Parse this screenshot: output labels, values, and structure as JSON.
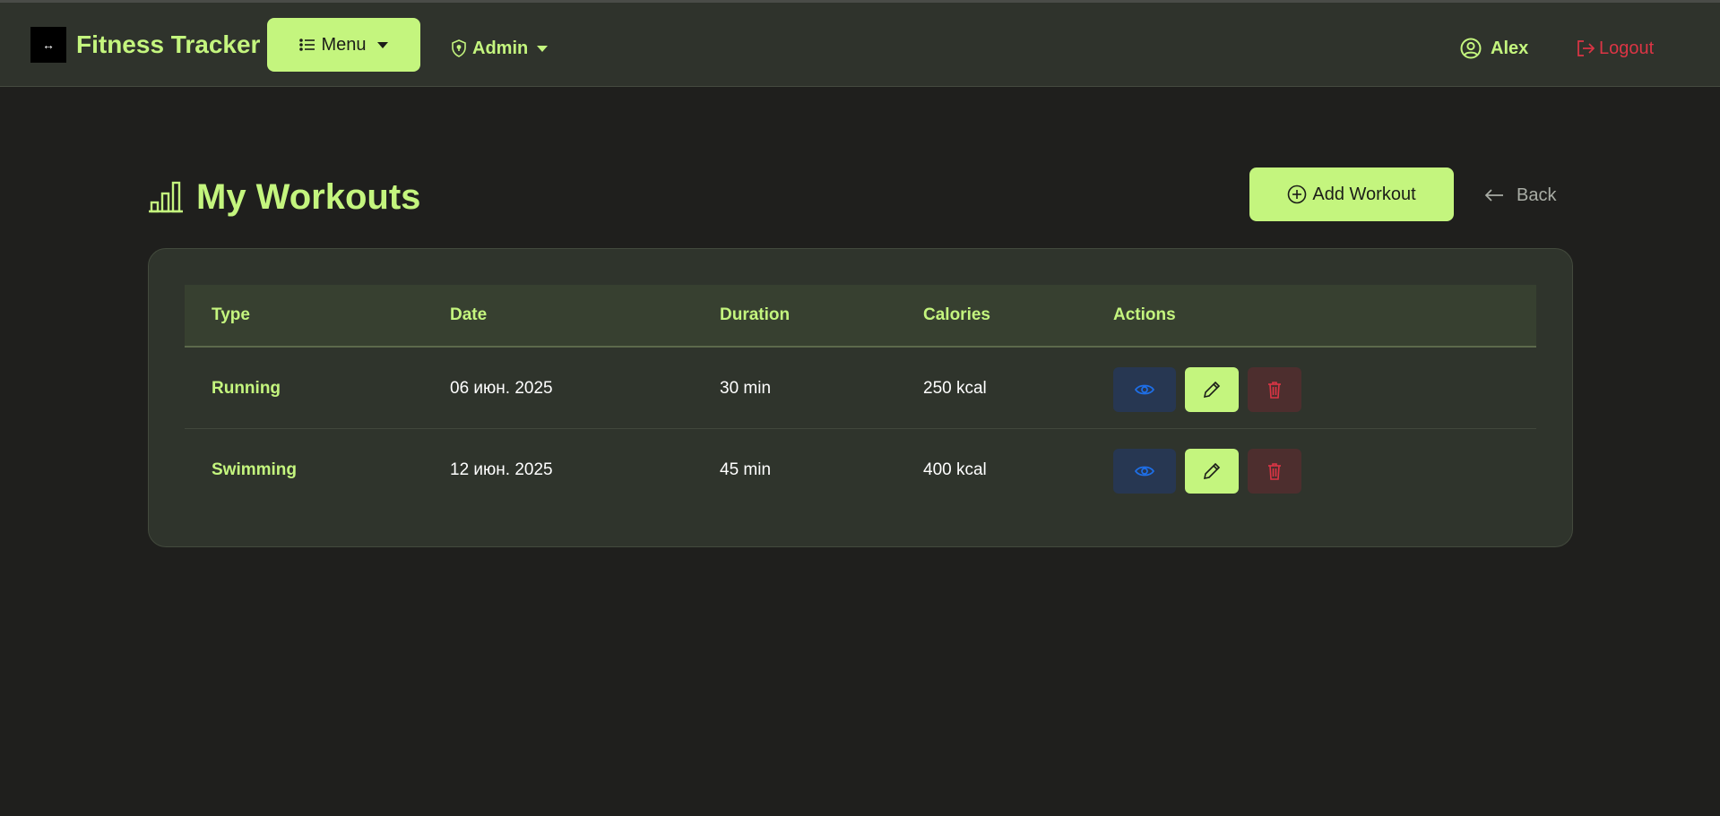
{
  "navbar": {
    "brand": "Fitness Tracker",
    "brand_logo_glyph": "↔",
    "menu_label": "Menu",
    "admin_label": "Admin",
    "user_name": "Alex",
    "logout_label": "Logout"
  },
  "page": {
    "title": "My Workouts",
    "add_button": "Add Workout",
    "back_link": "Back"
  },
  "table": {
    "headers": [
      "Type",
      "Date",
      "Duration",
      "Calories",
      "Actions"
    ],
    "rows": [
      {
        "type": "Running",
        "date": "06 июн. 2025",
        "duration": "30 min",
        "calories": "250 kcal"
      },
      {
        "type": "Swimming",
        "date": "12 июн. 2025",
        "duration": "45 min",
        "calories": "400 kcal"
      }
    ]
  },
  "icons": {
    "menu": "list-icon",
    "admin": "shield-icon",
    "user": "user-circle-icon",
    "logout": "logout-icon",
    "title": "bar-chart-icon",
    "add": "plus-circle-icon",
    "back": "arrow-left-icon",
    "view": "eye-icon",
    "edit": "pencil-icon",
    "delete": "trash-icon"
  },
  "colors": {
    "accent": "#c4f57e",
    "danger": "#dc3545",
    "info": "#1e6fe8",
    "background": "#1f1f1d",
    "navbar": "#2f332c",
    "card": "#2f342c"
  }
}
